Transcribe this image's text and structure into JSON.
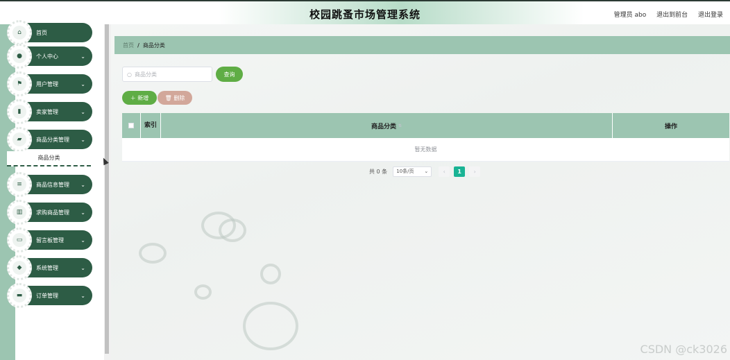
{
  "header": {
    "title": "校园跳蚤市场管理系统",
    "admin_label": "管理员 abo",
    "back_to_front": "退出到前台",
    "logout": "退出登录"
  },
  "sidebar": {
    "items": [
      {
        "label": "首页",
        "icon": "home-icon",
        "expandable": false
      },
      {
        "label": "个人中心",
        "icon": "user-icon",
        "expandable": true
      },
      {
        "label": "用户管理",
        "icon": "flag-icon",
        "expandable": true
      },
      {
        "label": "卖家管理",
        "icon": "chart-icon",
        "expandable": true
      },
      {
        "label": "商品分类管理",
        "icon": "folder-icon",
        "expandable": true
      },
      {
        "label": "商品信息管理",
        "icon": "list-icon",
        "expandable": true
      },
      {
        "label": "求购商品管理",
        "icon": "bar-chart-icon",
        "expandable": true
      },
      {
        "label": "留言板管理",
        "icon": "message-icon",
        "expandable": true
      },
      {
        "label": "系统管理",
        "icon": "shield-icon",
        "expandable": true
      },
      {
        "label": "订单管理",
        "icon": "monitor-icon",
        "expandable": true
      }
    ],
    "submenu_active": "商品分类"
  },
  "breadcrumb": {
    "home": "首页",
    "separator": "/",
    "current": "商品分类"
  },
  "search": {
    "placeholder": "商品分类",
    "query_label": "查询"
  },
  "actions": {
    "add_label": "新增",
    "delete_label": "删除"
  },
  "table": {
    "columns": [
      "索引",
      "商品分类",
      "操作"
    ],
    "empty_text": "暂无数据"
  },
  "pagination": {
    "total_text": "共 0 条",
    "page_size": "10条/页",
    "current_page": "1"
  },
  "watermark": "CSDN @ck3026",
  "colors": {
    "sidebar_item": "#2d5c45",
    "accent_bar": "#9cc5b1",
    "primary_button": "#5fad45",
    "danger_button": "#d2a79a",
    "active_page": "#19b394"
  }
}
